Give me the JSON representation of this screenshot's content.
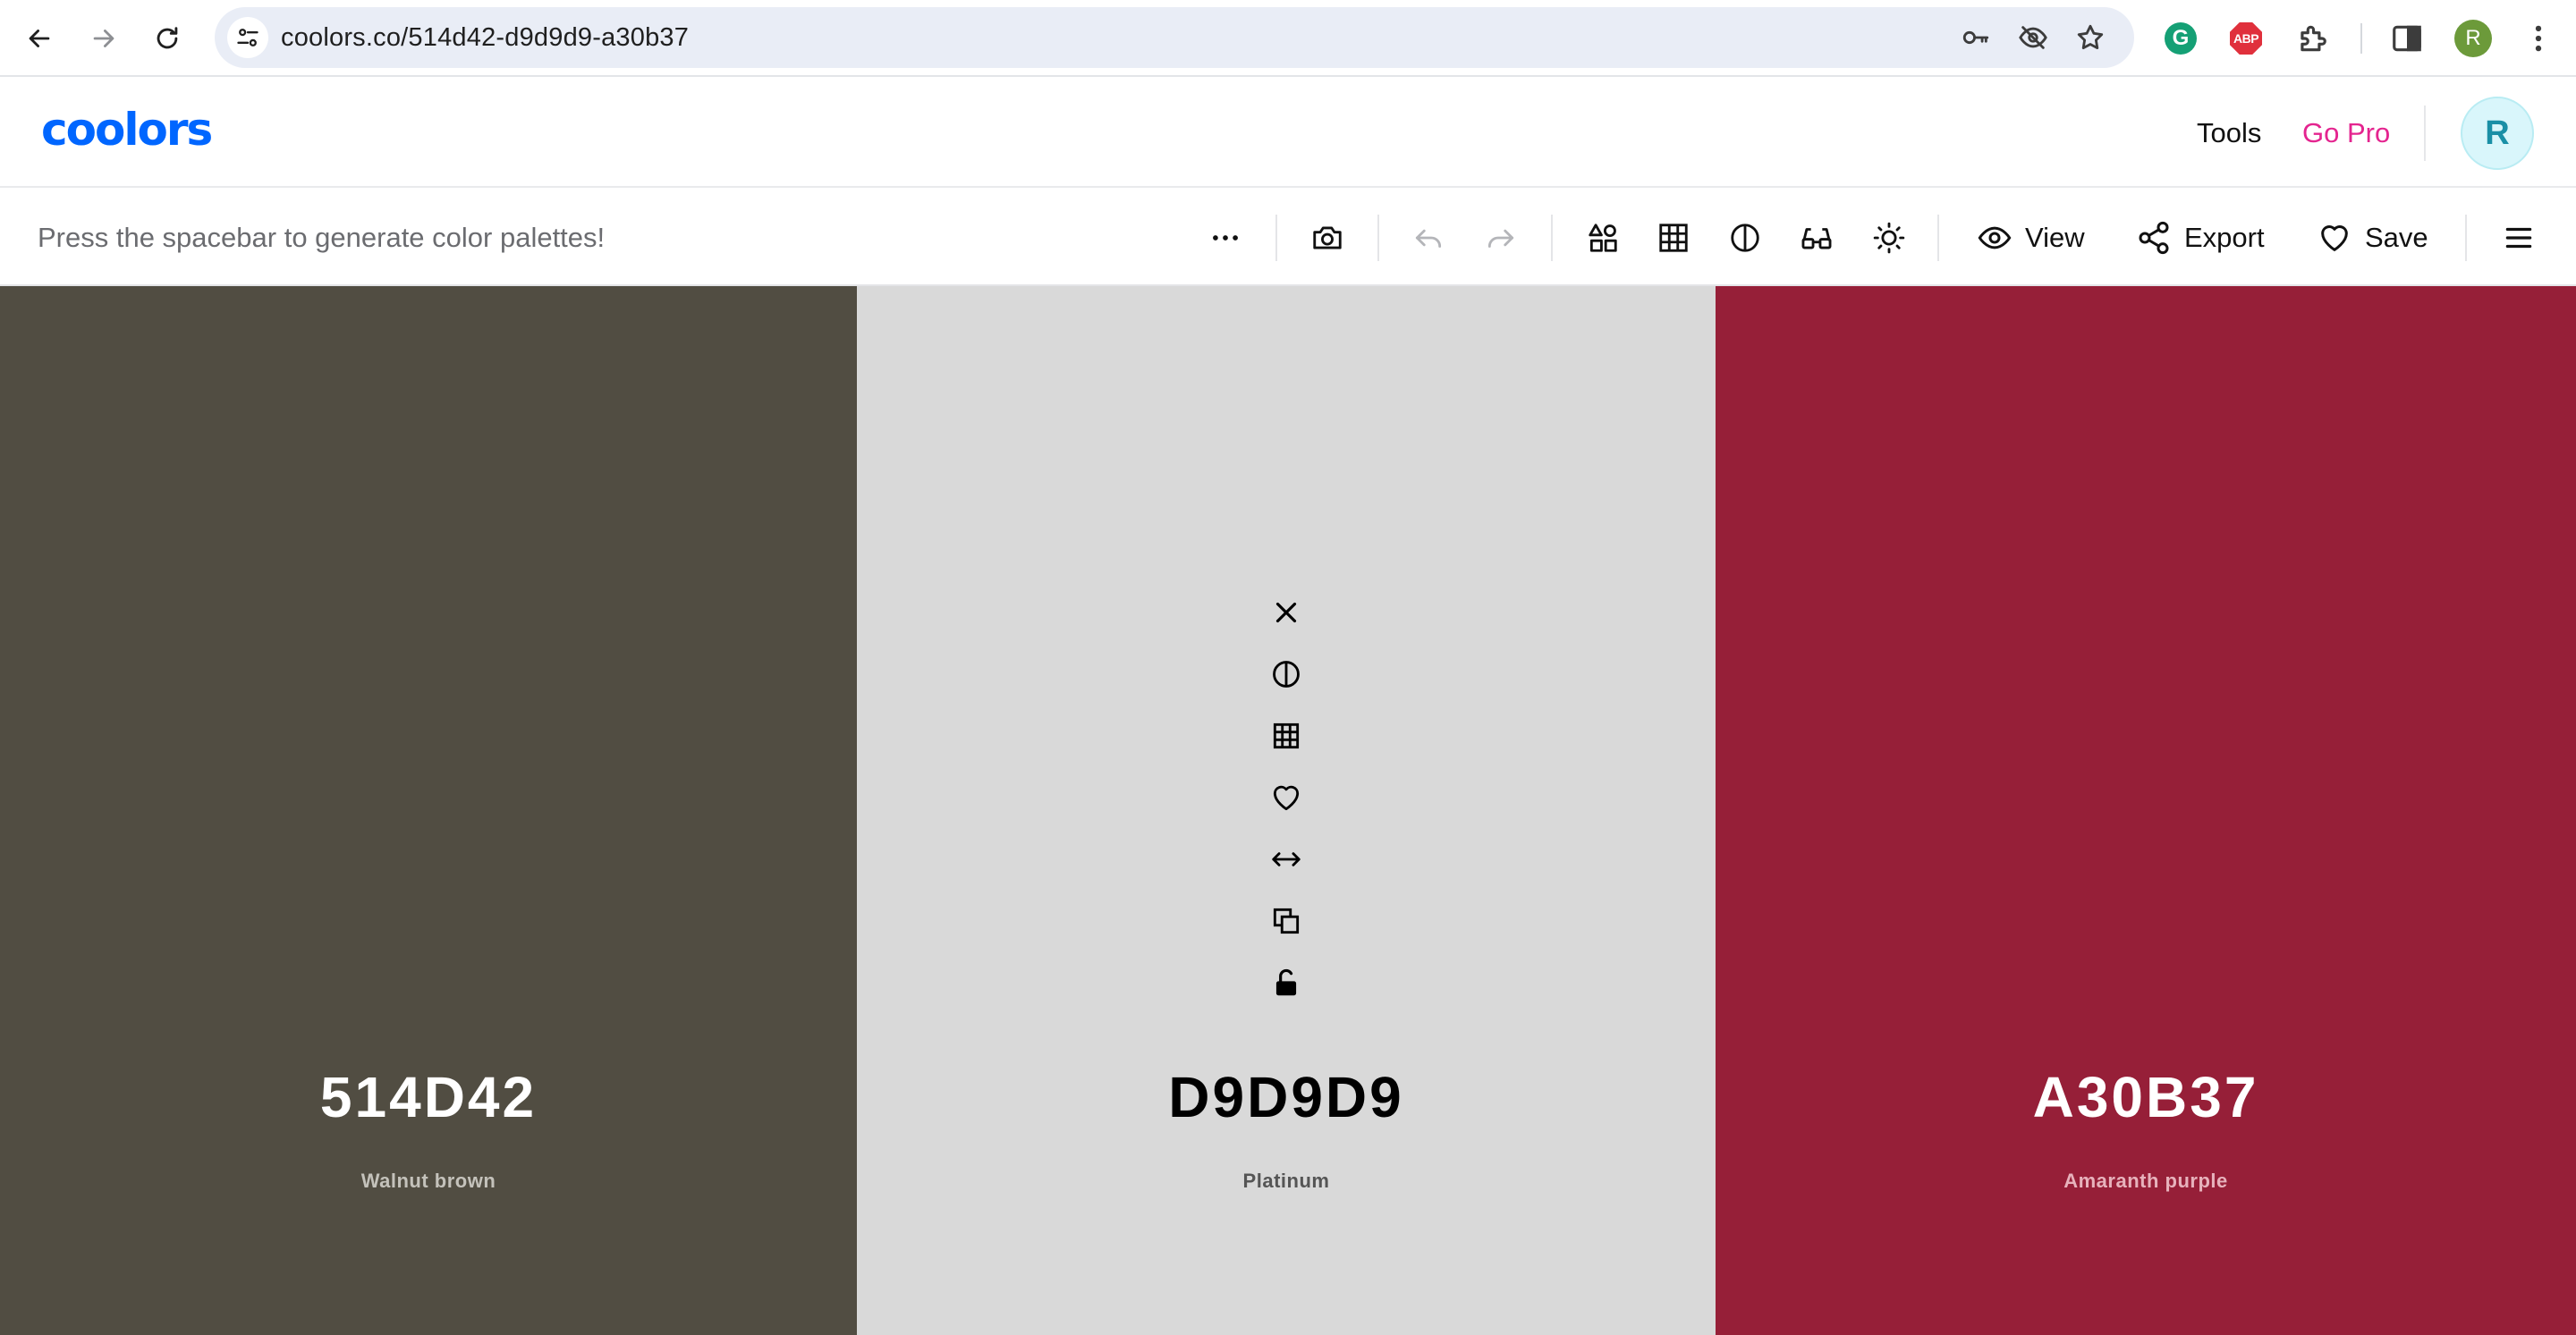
{
  "browser": {
    "url": "coolors.co/514d42-d9d9d9-a30b37",
    "profile_initial": "R",
    "extensions": [
      "grammarly-icon",
      "adblock-plus-icon",
      "puzzle-extensions-icon"
    ]
  },
  "header": {
    "logo": "coolors",
    "nav": {
      "tools": "Tools",
      "go_pro": "Go Pro"
    },
    "avatar_initial": "R"
  },
  "toolbar": {
    "hint": "Press the spacebar to generate color palettes!",
    "view_label": "View",
    "export_label": "Export",
    "save_label": "Save"
  },
  "palette": [
    {
      "hex": "514D42",
      "name": "Walnut brown",
      "bg": "#514d42",
      "fg": "#ffffff",
      "sub": "#c4c2bb"
    },
    {
      "hex": "D9D9D9",
      "name": "Platinum",
      "bg": "#d9d9d9",
      "fg": "#000000",
      "sub": "#555555"
    },
    {
      "hex": "A30B37",
      "name": "Amaranth purple",
      "bg": "#961f38",
      "fg": "#ffffff",
      "sub": "#e7b2bc"
    }
  ],
  "colors": {
    "brand": "#0066ff",
    "go_pro": "#e4248f"
  }
}
